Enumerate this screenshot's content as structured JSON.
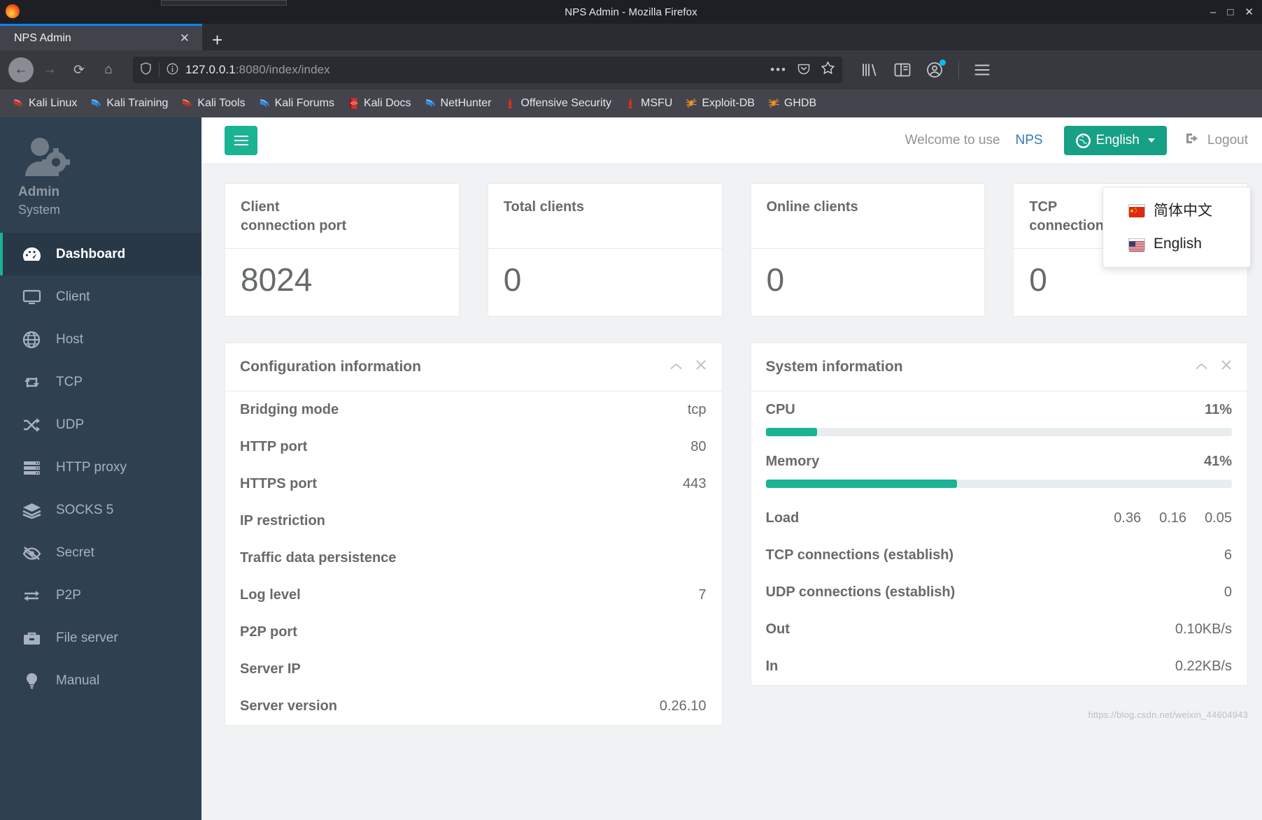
{
  "window": {
    "title": "NPS Admin - Mozilla Firefox",
    "minimize": "–",
    "maximize": "□",
    "close": "✕"
  },
  "browser": {
    "tab": {
      "title": "NPS Admin",
      "close_label": "✕"
    },
    "new_tab_label": "+",
    "nav": {
      "back": "←",
      "forward": "→",
      "reload": "⟳",
      "home": "⌂"
    },
    "url": {
      "host": "127.0.0.1",
      "rest": ":8080/index/index",
      "shield_icon": "shield-icon",
      "info_icon": "info-circle-icon",
      "more_label": "•••",
      "pocket_icon": "pocket-icon",
      "star_icon": "star-icon"
    },
    "toolbar": {
      "library_icon": "library-icon",
      "sidebar_icon": "sidebar-icon",
      "account_icon": "account-icon",
      "menu_icon": "hamburger-menu-icon"
    },
    "bookmarks": [
      {
        "label": "Kali Linux",
        "icon": "kali-dragon-icon"
      },
      {
        "label": "Kali Training",
        "icon": "kali-dragon-icon"
      },
      {
        "label": "Kali Tools",
        "icon": "kali-dragon-icon"
      },
      {
        "label": "Kali Forums",
        "icon": "kali-dragon-icon"
      },
      {
        "label": "Kali Docs",
        "icon": "kali-docs-book-icon"
      },
      {
        "label": "NetHunter",
        "icon": "kali-dragon-icon"
      },
      {
        "label": "Offensive Security",
        "icon": "offsec-icon"
      },
      {
        "label": "MSFU",
        "icon": "offsec-icon"
      },
      {
        "label": "Exploit-DB",
        "icon": "spider-icon"
      },
      {
        "label": "GHDB",
        "icon": "spider-icon"
      }
    ]
  },
  "sidebar": {
    "profile": {
      "name": "Admin",
      "role": "System",
      "avatar_icon": "user-gear-icon"
    },
    "items": [
      {
        "label": "Dashboard",
        "icon": "dashboard-gauge-icon",
        "active": true
      },
      {
        "label": "Client",
        "icon": "monitor-icon",
        "active": false
      },
      {
        "label": "Host",
        "icon": "globe-icon",
        "active": false
      },
      {
        "label": "TCP",
        "icon": "exchange-arrows-icon",
        "active": false
      },
      {
        "label": "UDP",
        "icon": "random-arrows-icon",
        "active": false
      },
      {
        "label": "HTTP proxy",
        "icon": "server-rack-icon",
        "active": false
      },
      {
        "label": "SOCKS 5",
        "icon": "layers-icon",
        "active": false
      },
      {
        "label": "Secret",
        "icon": "eye-slash-icon",
        "active": false
      },
      {
        "label": "P2P",
        "icon": "two-way-arrows-icon",
        "active": false
      },
      {
        "label": "File server",
        "icon": "briefcase-icon",
        "active": false
      },
      {
        "label": "Manual",
        "icon": "lightbulb-icon",
        "active": false
      }
    ]
  },
  "topbar": {
    "menu_toggle_icon": "hamburger-icon",
    "welcome_text": "Welcome to use",
    "brand_link": "NPS",
    "language_button": "English",
    "language_icon": "globe-icon",
    "logout_label": "Logout",
    "logout_icon": "sign-out-icon"
  },
  "language_menu": {
    "open": true,
    "items": [
      {
        "label": "简体中文",
        "flag": "cn"
      },
      {
        "label": "English",
        "flag": "us"
      }
    ]
  },
  "stats": [
    {
      "title": "Client\nconnection port",
      "value": "8024",
      "two_line": true
    },
    {
      "title": "Total clients",
      "value": "0",
      "two_line": false
    },
    {
      "title": "Online clients",
      "value": "0",
      "two_line": false
    },
    {
      "title": "TCP\nconnections",
      "value": "0",
      "two_line": true
    }
  ],
  "config_panel": {
    "title": "Configuration information",
    "collapse_icon": "chevron-up-icon",
    "close_icon": "close-icon",
    "rows": [
      {
        "key": "Bridging mode",
        "value": "tcp"
      },
      {
        "key": "HTTP port",
        "value": "80"
      },
      {
        "key": "HTTPS port",
        "value": "443"
      },
      {
        "key": "IP restriction",
        "value": ""
      },
      {
        "key": "Traffic data persistence",
        "value": ""
      },
      {
        "key": "Log level",
        "value": "7"
      },
      {
        "key": "P2P port",
        "value": ""
      },
      {
        "key": "Server IP",
        "value": ""
      },
      {
        "key": "Server version",
        "value": "0.26.10"
      }
    ]
  },
  "system_panel": {
    "title": "System information",
    "collapse_icon": "chevron-up-icon",
    "close_icon": "close-icon",
    "meters": [
      {
        "key": "CPU",
        "value": "11%",
        "percent": 11
      },
      {
        "key": "Memory",
        "value": "41%",
        "percent": 41
      }
    ],
    "load": {
      "key": "Load",
      "values": [
        "0.36",
        "0.16",
        "0.05"
      ]
    },
    "rows": [
      {
        "key": "TCP connections (establish)",
        "value": "6"
      },
      {
        "key": "UDP connections (establish)",
        "value": "0"
      },
      {
        "key": "Out",
        "value": "0.10KB/s"
      },
      {
        "key": "In",
        "value": "0.22KB/s"
      }
    ]
  },
  "watermark": "https://blog.csdn.net/weixin_44604943",
  "colors": {
    "accent": "#1ab394",
    "sidebar": "#2f4050",
    "sidebar_active": "#293846",
    "text": "#676a6c",
    "link": "#337ab7",
    "lang_button": "#16a085"
  }
}
